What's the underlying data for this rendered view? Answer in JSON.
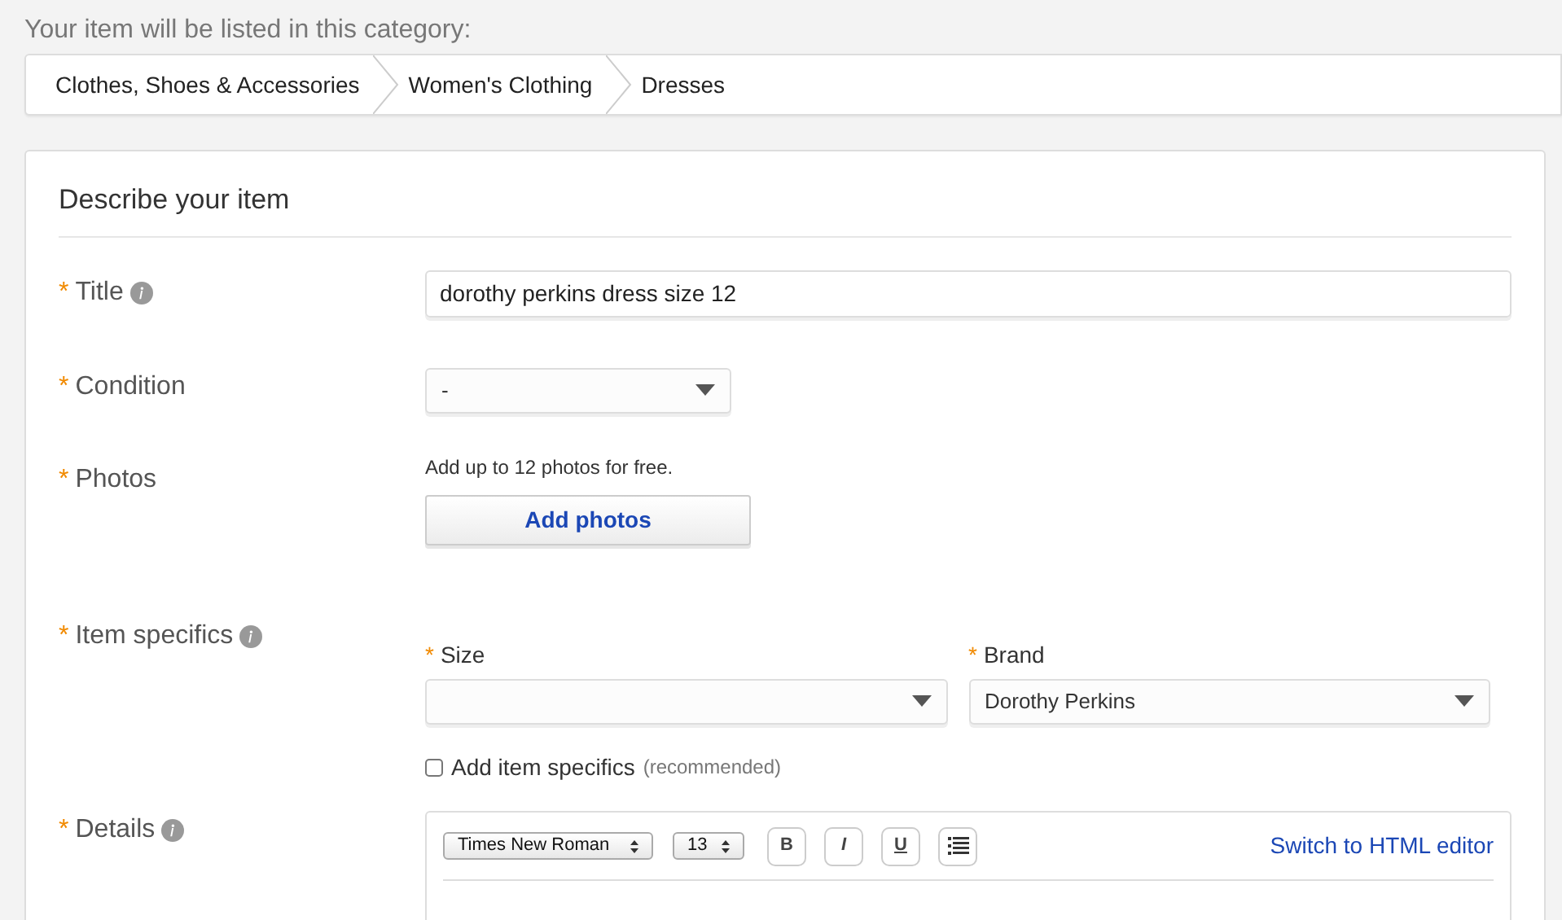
{
  "category_heading": "Your item will be listed in this category:",
  "breadcrumb": [
    "Clothes, Shoes & Accessories",
    "Women's Clothing",
    "Dresses"
  ],
  "form": {
    "title": "Describe your item",
    "fields": [
      {
        "kind": "text",
        "label": "Title",
        "marker": "*",
        "info": true,
        "value": "dorothy perkins dress size 12"
      },
      {
        "kind": "select",
        "label": "Condition",
        "marker": "*",
        "info": false,
        "value": "-"
      },
      {
        "kind": "photos",
        "label": "Photos",
        "marker": "*",
        "info": false,
        "hint": "Add up to 12 photos for free.",
        "button": "Add photos"
      },
      {
        "kind": "specifics",
        "label": "Item specifics",
        "marker": "*",
        "info": true,
        "specifics": [
          {
            "label": "Size",
            "marker": "*"
          },
          {
            "label": "Brand",
            "marker": "*",
            "value": "Dorothy Perkins"
          }
        ],
        "checkbox": {
          "label": "Add item specifics",
          "note": "(recommended)",
          "checked": false
        }
      },
      {
        "kind": "editor",
        "label": "Details",
        "marker": "*",
        "info": true,
        "font": "Times New Roman",
        "size": "13",
        "format_buttons": [
          {
            "kind": "bold",
            "label": "B"
          },
          {
            "kind": "italic",
            "label": "I"
          },
          {
            "kind": "underline",
            "label": "U"
          }
        ],
        "link": "Switch to HTML editor"
      }
    ]
  }
}
